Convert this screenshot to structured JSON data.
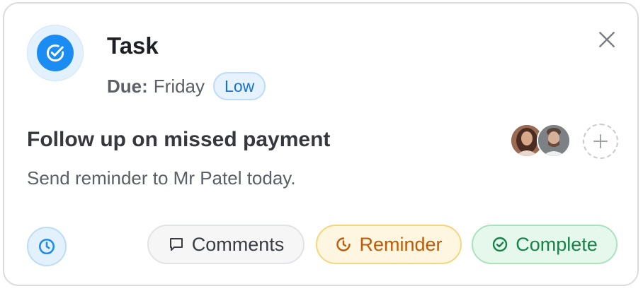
{
  "task": {
    "heading": "Task",
    "due_label": "Due:",
    "due_value": "Friday",
    "priority": "Low"
  },
  "item": {
    "title": "Follow up on missed payment",
    "description": "Send reminder to Mr Patel today."
  },
  "actions": {
    "comments": "Comments",
    "reminder": "Reminder",
    "complete": "Complete"
  },
  "colors": {
    "accent_blue": "#1b8cf2",
    "reminder_orange": "#c15a06",
    "complete_green": "#16834a"
  },
  "icons": {
    "task": "check-circle-icon",
    "close": "close-icon",
    "add": "plus-icon",
    "clock": "clock-icon",
    "comments": "comment-icon",
    "reminder": "reminder-clock-icon",
    "complete": "check-circle-outline-icon"
  }
}
